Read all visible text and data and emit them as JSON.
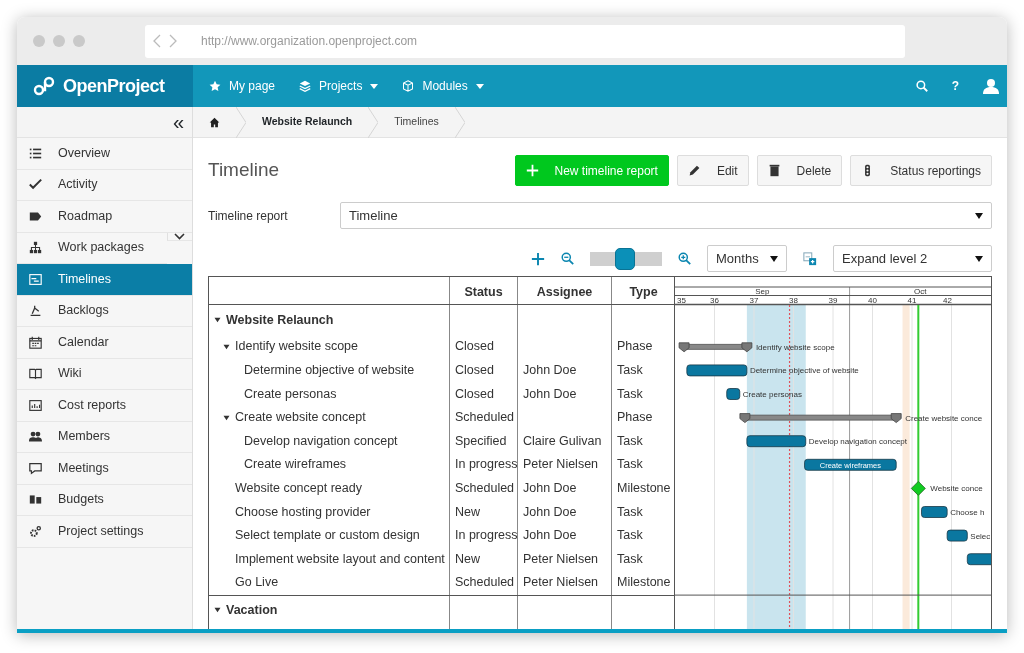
{
  "browser": {
    "url": "http://www.organization.openproject.com"
  },
  "header": {
    "logo": "OpenProject",
    "nav": [
      {
        "label": "My page",
        "dropdown": false
      },
      {
        "label": "Projects",
        "dropdown": true
      },
      {
        "label": "Modules",
        "dropdown": true
      }
    ],
    "help": "?"
  },
  "sidebar": {
    "collapse": "«",
    "items": [
      {
        "label": "Overview",
        "selected": false,
        "submenu": false
      },
      {
        "label": "Activity",
        "selected": false,
        "submenu": false
      },
      {
        "label": "Roadmap",
        "selected": false,
        "submenu": false
      },
      {
        "label": "Work packages",
        "selected": false,
        "submenu": true
      },
      {
        "label": "Timelines",
        "selected": true,
        "submenu": false
      },
      {
        "label": "Backlogs",
        "selected": false,
        "submenu": false
      },
      {
        "label": "Calendar",
        "selected": false,
        "submenu": false
      },
      {
        "label": "Wiki",
        "selected": false,
        "submenu": false
      },
      {
        "label": "Cost reports",
        "selected": false,
        "submenu": false
      },
      {
        "label": "Members",
        "selected": false,
        "submenu": false
      },
      {
        "label": "Meetings",
        "selected": false,
        "submenu": false
      },
      {
        "label": "Budgets",
        "selected": false,
        "submenu": false
      },
      {
        "label": "Project settings",
        "selected": false,
        "submenu": false
      }
    ]
  },
  "breadcrumb": [
    "Website Relaunch",
    "Timelines"
  ],
  "page": {
    "title": "Timeline",
    "buttons": [
      {
        "label": "New timeline report",
        "kind": "primary"
      },
      {
        "label": "Edit",
        "kind": "edit"
      },
      {
        "label": "Delete",
        "kind": "delete"
      },
      {
        "label": "Status reportings",
        "kind": "status"
      }
    ],
    "report_label": "Timeline report",
    "report_value": "Timeline"
  },
  "toolbar": {
    "zoom_slider": {
      "level": 0.49
    },
    "scale": "Months",
    "expand": "Expand level 2"
  },
  "table": {
    "columns": [
      "Status",
      "Assignee",
      "Type"
    ],
    "rows": [
      {
        "name": "Website Relaunch",
        "kind": "project",
        "expanded": true,
        "children": [
          {
            "name": "Identify website scope",
            "status": "Closed",
            "type": "Phase",
            "expanded": true,
            "bar": {
              "kind": "summary",
              "label": "Identify website scope"
            },
            "children": [
              {
                "name": "Determine objective of website",
                "status": "Closed",
                "assignee": "John Doe",
                "type": "Task",
                "bar": {
                  "kind": "task",
                  "label": "Determine objective of website"
                }
              },
              {
                "name": "Create personas",
                "status": "Closed",
                "assignee": "John Doe",
                "type": "Task",
                "bar": {
                  "kind": "task",
                  "label": "Create personas"
                }
              }
            ]
          },
          {
            "name": "Create website concept",
            "status": "Scheduled",
            "type": "Phase",
            "expanded": true,
            "bar": {
              "kind": "summary",
              "label": "Create website conce"
            },
            "children": [
              {
                "name": "Develop navigation concept",
                "status": "Specified",
                "assignee": "Claire Gulivan",
                "type": "Task",
                "bar": {
                  "kind": "task",
                  "label": "Develop navigation concept"
                }
              },
              {
                "name": "Create wireframes",
                "status": "In progress",
                "assignee": "Peter Nielsen",
                "type": "Task",
                "bar": {
                  "kind": "task",
                  "label": "Create wireframes"
                }
              }
            ]
          },
          {
            "name": "Website concept ready",
            "status": "Scheduled",
            "assignee": "John Doe",
            "type": "Milestone",
            "bar": {
              "kind": "milestone",
              "label": "Website conce"
            }
          },
          {
            "name": "Choose hosting provider",
            "status": "New",
            "assignee": "John Doe",
            "type": "Task",
            "bar": {
              "kind": "task",
              "label": "Choose h"
            }
          },
          {
            "name": "Select template or custom design",
            "status": "In progress",
            "assignee": "John Doe",
            "type": "Task",
            "bar": {
              "kind": "task",
              "label": "Selec"
            }
          },
          {
            "name": "Implement website layout and content",
            "status": "New",
            "assignee": "Peter Nielsen",
            "type": "Task",
            "bar": {
              "kind": "task"
            }
          },
          {
            "name": "Go Live",
            "status": "Scheduled",
            "assignee": "Peter Nielsen",
            "type": "Milestone"
          }
        ]
      },
      {
        "name": "Vacation",
        "kind": "project",
        "expanded": true
      }
    ]
  },
  "timeline": {
    "months": [
      "Sep",
      "Oct"
    ],
    "weeks": [
      "35",
      "36",
      "37",
      "38",
      "39",
      "40",
      "41",
      "42"
    ]
  }
}
